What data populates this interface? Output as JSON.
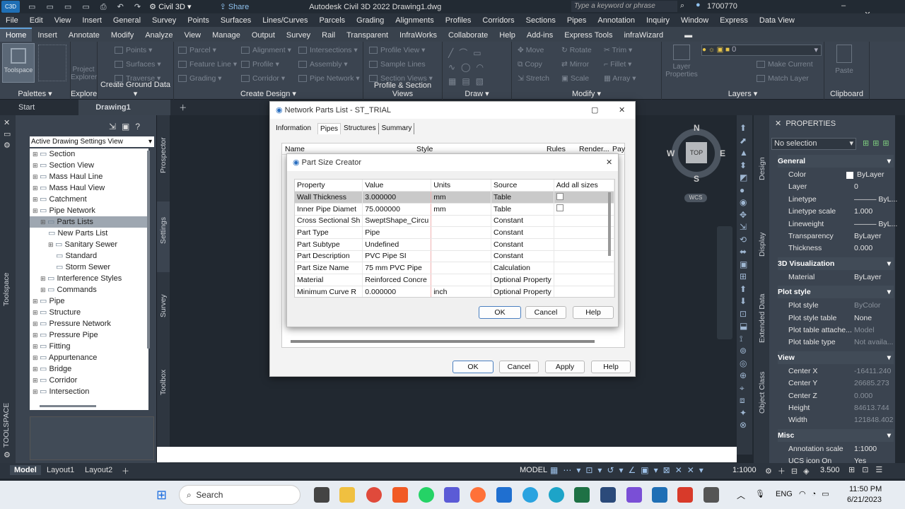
{
  "title_bar": {
    "app": "Civil 3D",
    "share": "Share",
    "title": "Autodesk Civil 3D 2022 Drawing1.dwg",
    "search_placeholder": "Type a keyword or phrase",
    "user_id": "1700770"
  },
  "menu": [
    "File",
    "Edit",
    "View",
    "Insert",
    "General",
    "Survey",
    "Points",
    "Surfaces",
    "Lines/Curves",
    "Parcels",
    "Grading",
    "Alignments",
    "Profiles",
    "Corridors",
    "Sections",
    "Pipes",
    "Annotation",
    "Inquiry",
    "Window",
    "Express",
    "Data View"
  ],
  "ribbon_tabs": [
    "Home",
    "Insert",
    "Annotate",
    "Modify",
    "Analyze",
    "View",
    "Manage",
    "Output",
    "Survey",
    "Rail",
    "Transparent",
    "InfraWorks",
    "Collaborate",
    "Help",
    "Add-ins",
    "Express Tools",
    "infraWizard"
  ],
  "ribbon": {
    "palettes": "Palettes",
    "toolspace": "Toolspace",
    "explore_label": "Explore",
    "project_explorer": "Project Explorer",
    "ground": {
      "label": "Create Ground Data",
      "items": [
        "Points",
        "Surfaces",
        "Traverse"
      ]
    },
    "design": {
      "label": "Create Design",
      "items": [
        "Parcel",
        "Feature Line",
        "Grading",
        "Alignment",
        "Profile",
        "Corridor",
        "Intersections",
        "Assembly",
        "Pipe Network"
      ]
    },
    "profile": {
      "label": "Profile & Section Views",
      "items": [
        "Profile View",
        "Sample Lines",
        "Section Views"
      ]
    },
    "draw": "Draw",
    "modify": {
      "label": "Modify",
      "items": [
        "Move",
        "Copy",
        "Stretch",
        "Rotate",
        "Mirror",
        "Scale",
        "Trim",
        "Fillet",
        "Array"
      ]
    },
    "layers": {
      "label": "Layers",
      "items": [
        "Layer Properties",
        "Make Current",
        "Match Layer"
      ],
      "current": "0"
    },
    "clipboard": {
      "label": "Clipboard",
      "paste": "Paste"
    }
  },
  "doc_tabs": [
    "Start",
    "Drawing1"
  ],
  "toolspace": {
    "view": "Active Drawing Settings View",
    "side_tabs": [
      "Prospector",
      "Settings",
      "Survey",
      "Toolbox"
    ],
    "left_label": "Toolspace",
    "footer_label": "TOOLSPACE",
    "tree": [
      "Section",
      "Section View",
      "Mass Haul Line",
      "Mass Haul View",
      "Catchment",
      "Pipe Network",
      "Parts Lists",
      "New Parts List",
      "Sanitary Sewer",
      "Standard",
      "Storm Sewer",
      "Interference Styles",
      "Commands",
      "Pipe",
      "Structure",
      "Pressure Network",
      "Pressure Pipe",
      "Fitting",
      "Appurtenance",
      "Bridge",
      "Corridor",
      "Intersection"
    ]
  },
  "network_dialog": {
    "title": "Network Parts List - ST_TRIAL",
    "tabs": [
      "Information",
      "Pipes",
      "Structures",
      "Summary"
    ],
    "columns": [
      "Name",
      "Style",
      "Rules",
      "Render...",
      "Pay"
    ],
    "buttons": [
      "OK",
      "Cancel",
      "Apply",
      "Help"
    ]
  },
  "size_dialog": {
    "title": "Part Size Creator",
    "headers": [
      "Property",
      "Value",
      "Units",
      "Source",
      "Add all sizes"
    ],
    "rows": [
      [
        "Wall Thickness",
        "3.000000",
        "mm",
        "Table"
      ],
      [
        "Inner Pipe Diamet",
        "75.000000",
        "mm",
        "Table"
      ],
      [
        "Cross Sectional Sh",
        "SweptShape_Circu",
        "",
        "Constant"
      ],
      [
        "Part Type",
        "Pipe",
        "",
        "Constant"
      ],
      [
        "Part Subtype",
        "Undefined",
        "",
        "Constant"
      ],
      [
        "Part Description",
        "PVC Pipe SI",
        "",
        "Constant"
      ],
      [
        "Part Size Name",
        "75 mm PVC Pipe",
        "",
        "Calculation"
      ],
      [
        "Material",
        "Reinforced Concre",
        "",
        "Optional Property"
      ],
      [
        "Minimum Curve R",
        "0.000000",
        "inch",
        "Optional Property"
      ]
    ],
    "buttons": [
      "OK",
      "Cancel",
      "Help"
    ]
  },
  "viewcube": {
    "n": "N",
    "s": "S",
    "e": "E",
    "w": "W",
    "top": "TOP",
    "wcs": "WCS"
  },
  "properties": {
    "header": "PROPERTIES",
    "selection": "No selection",
    "side_tabs": [
      "Design",
      "Display",
      "Extended Data",
      "Object Class"
    ],
    "sections": [
      {
        "name": "General",
        "rows": [
          [
            "Color",
            "ByLayer"
          ],
          [
            "Layer",
            "0"
          ],
          [
            "Linetype",
            "——— ByL..."
          ],
          [
            "Linetype scale",
            "1.000"
          ],
          [
            "Lineweight",
            "——— ByL..."
          ],
          [
            "Transparency",
            "ByLayer"
          ],
          [
            "Thickness",
            "0.000"
          ]
        ]
      },
      {
        "name": "3D Visualization",
        "rows": [
          [
            "Material",
            "ByLayer"
          ]
        ]
      },
      {
        "name": "Plot style",
        "rows": [
          [
            "Plot style",
            "ByColor"
          ],
          [
            "Plot style table",
            "None"
          ],
          [
            "Plot table attache...",
            "Model"
          ],
          [
            "Plot table type",
            "Not availa..."
          ]
        ]
      },
      {
        "name": "View",
        "rows": [
          [
            "Center X",
            "-16411.240"
          ],
          [
            "Center Y",
            "26685.273"
          ],
          [
            "Center Z",
            "0.000"
          ],
          [
            "Height",
            "84613.744"
          ],
          [
            "Width",
            "121848.402"
          ]
        ]
      },
      {
        "name": "Misc",
        "rows": [
          [
            "Annotation scale",
            "1:1000"
          ],
          [
            "UCS icon On",
            "Yes"
          ]
        ]
      }
    ]
  },
  "status": {
    "tabs": [
      "Model",
      "Layout1",
      "Layout2"
    ],
    "model": "MODEL",
    "scale": "1:1000",
    "value": "3.500"
  },
  "taskbar": {
    "search": "Search",
    "lang": "ENG",
    "time": "11:50 PM",
    "date": "6/21/2023"
  }
}
